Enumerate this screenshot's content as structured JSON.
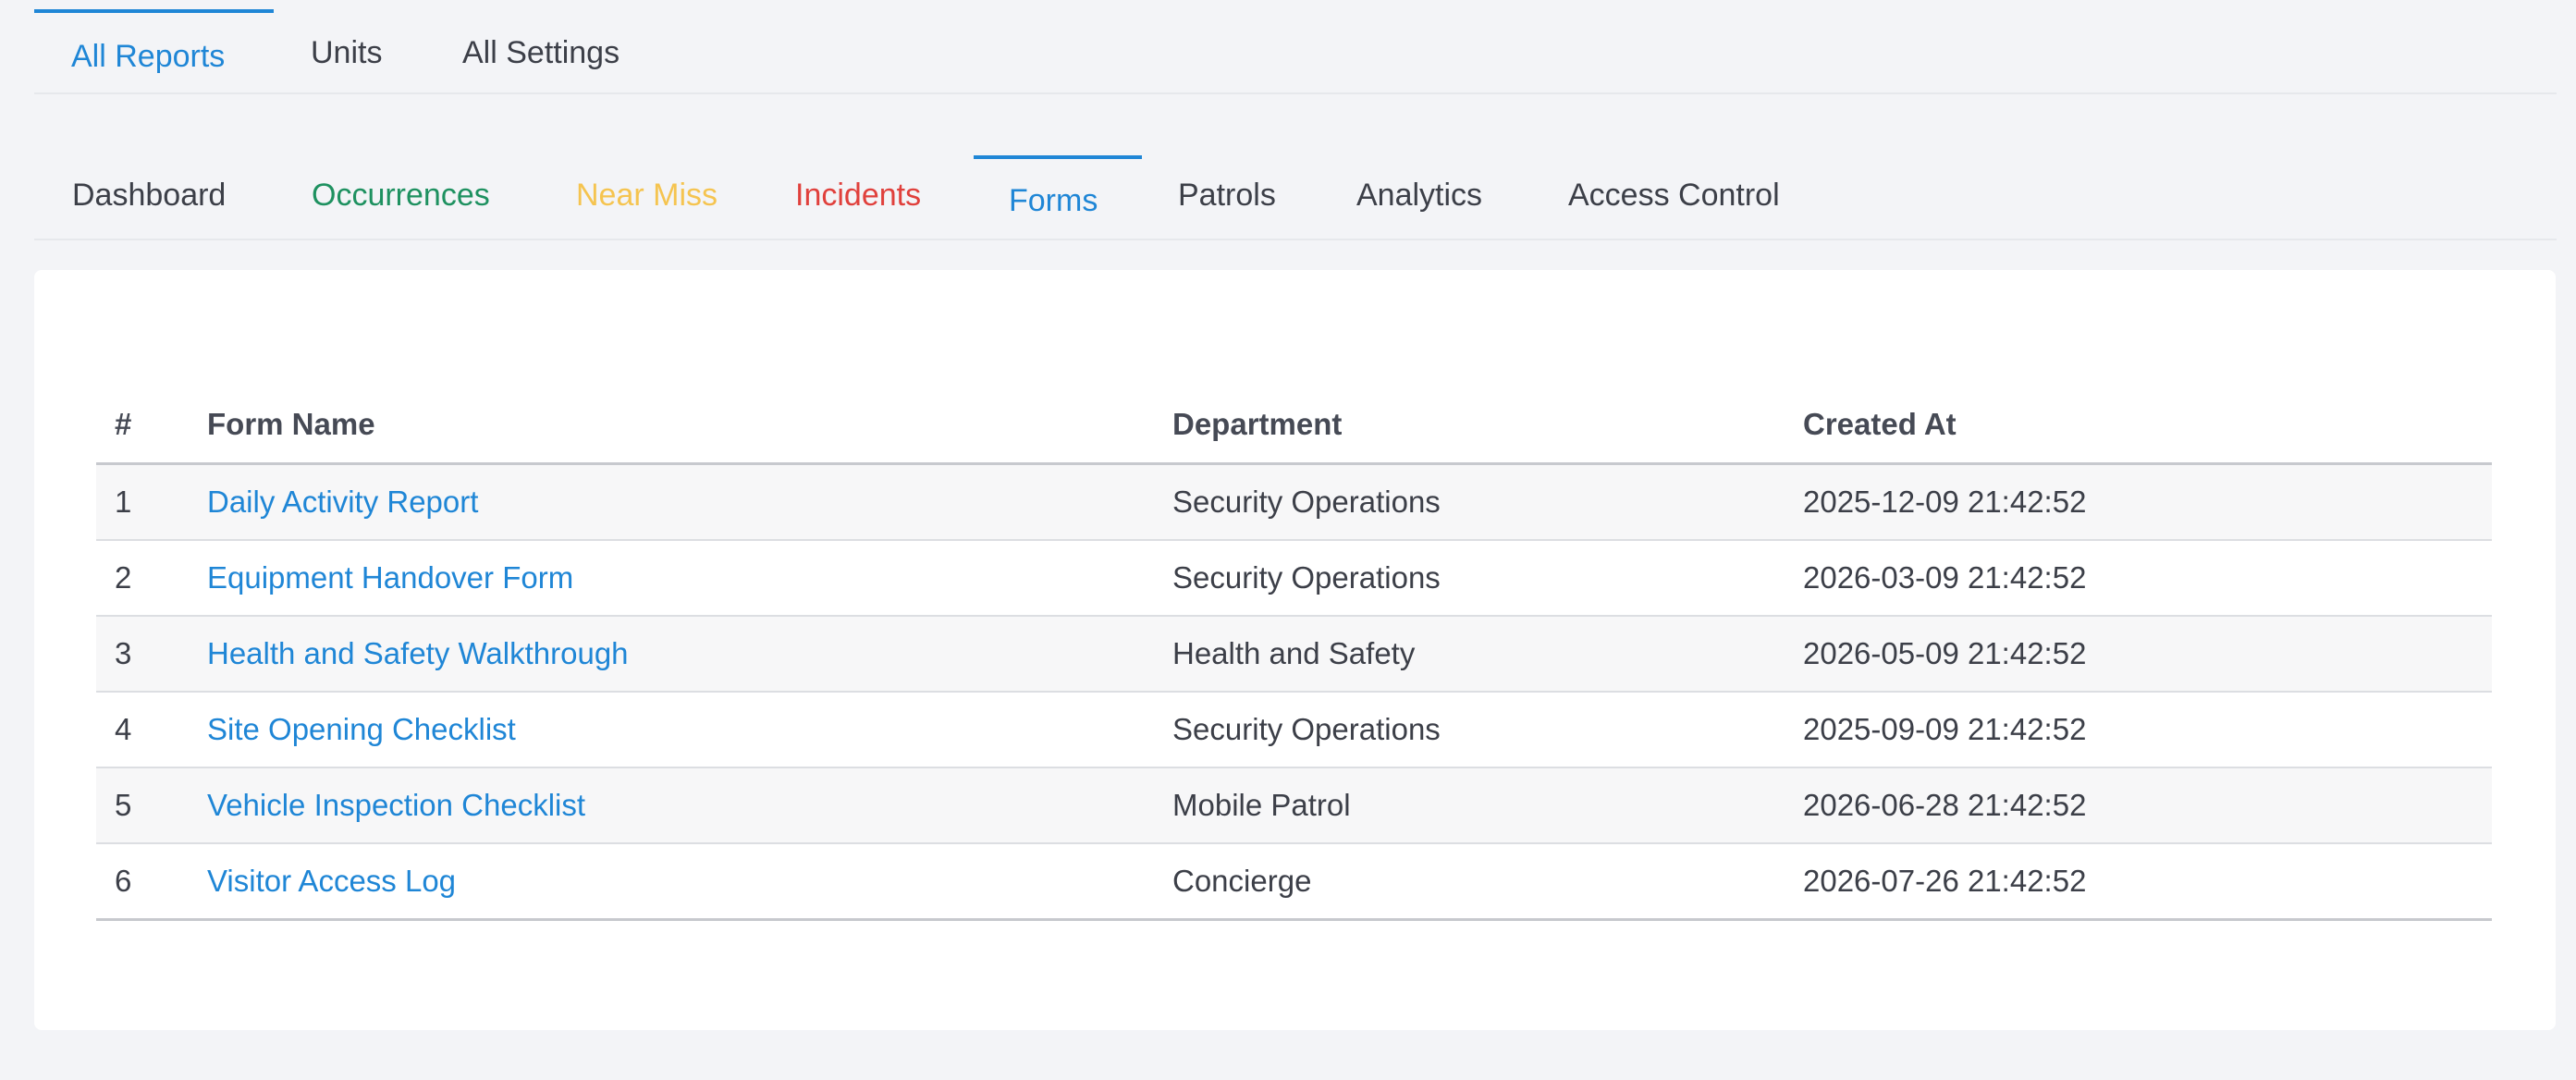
{
  "top_tabs": {
    "all_reports": "All Reports",
    "units": "Units",
    "all_settings": "All Settings"
  },
  "sub_tabs": {
    "dashboard": "Dashboard",
    "occurrences": "Occurrences",
    "near_miss": "Near Miss",
    "incidents": "Incidents",
    "forms": "Forms",
    "patrols": "Patrols",
    "analytics": "Analytics",
    "access_control": "Access Control"
  },
  "colors": {
    "accent": "#1f86d6",
    "occurrences": "#1e9160",
    "near_miss": "#f5c450",
    "incidents": "#e0403c",
    "text": "#3c3f48"
  },
  "table": {
    "headers": {
      "num": "#",
      "name": "Form Name",
      "department": "Department",
      "created": "Created At"
    },
    "rows": [
      {
        "num": "1",
        "name": "Daily Activity Report",
        "department": "Security Operations",
        "created": "2025-12-09 21:42:52"
      },
      {
        "num": "2",
        "name": "Equipment Handover Form",
        "department": "Security Operations",
        "created": "2026-03-09 21:42:52"
      },
      {
        "num": "3",
        "name": "Health and Safety Walkthrough",
        "department": "Health and Safety",
        "created": "2026-05-09 21:42:52"
      },
      {
        "num": "4",
        "name": "Site Opening Checklist",
        "department": "Security Operations",
        "created": "2025-09-09 21:42:52"
      },
      {
        "num": "5",
        "name": "Vehicle Inspection Checklist",
        "department": "Mobile Patrol",
        "created": "2026-06-28 21:42:52"
      },
      {
        "num": "6",
        "name": "Visitor Access Log",
        "department": "Concierge",
        "created": "2026-07-26 21:42:52"
      }
    ]
  }
}
